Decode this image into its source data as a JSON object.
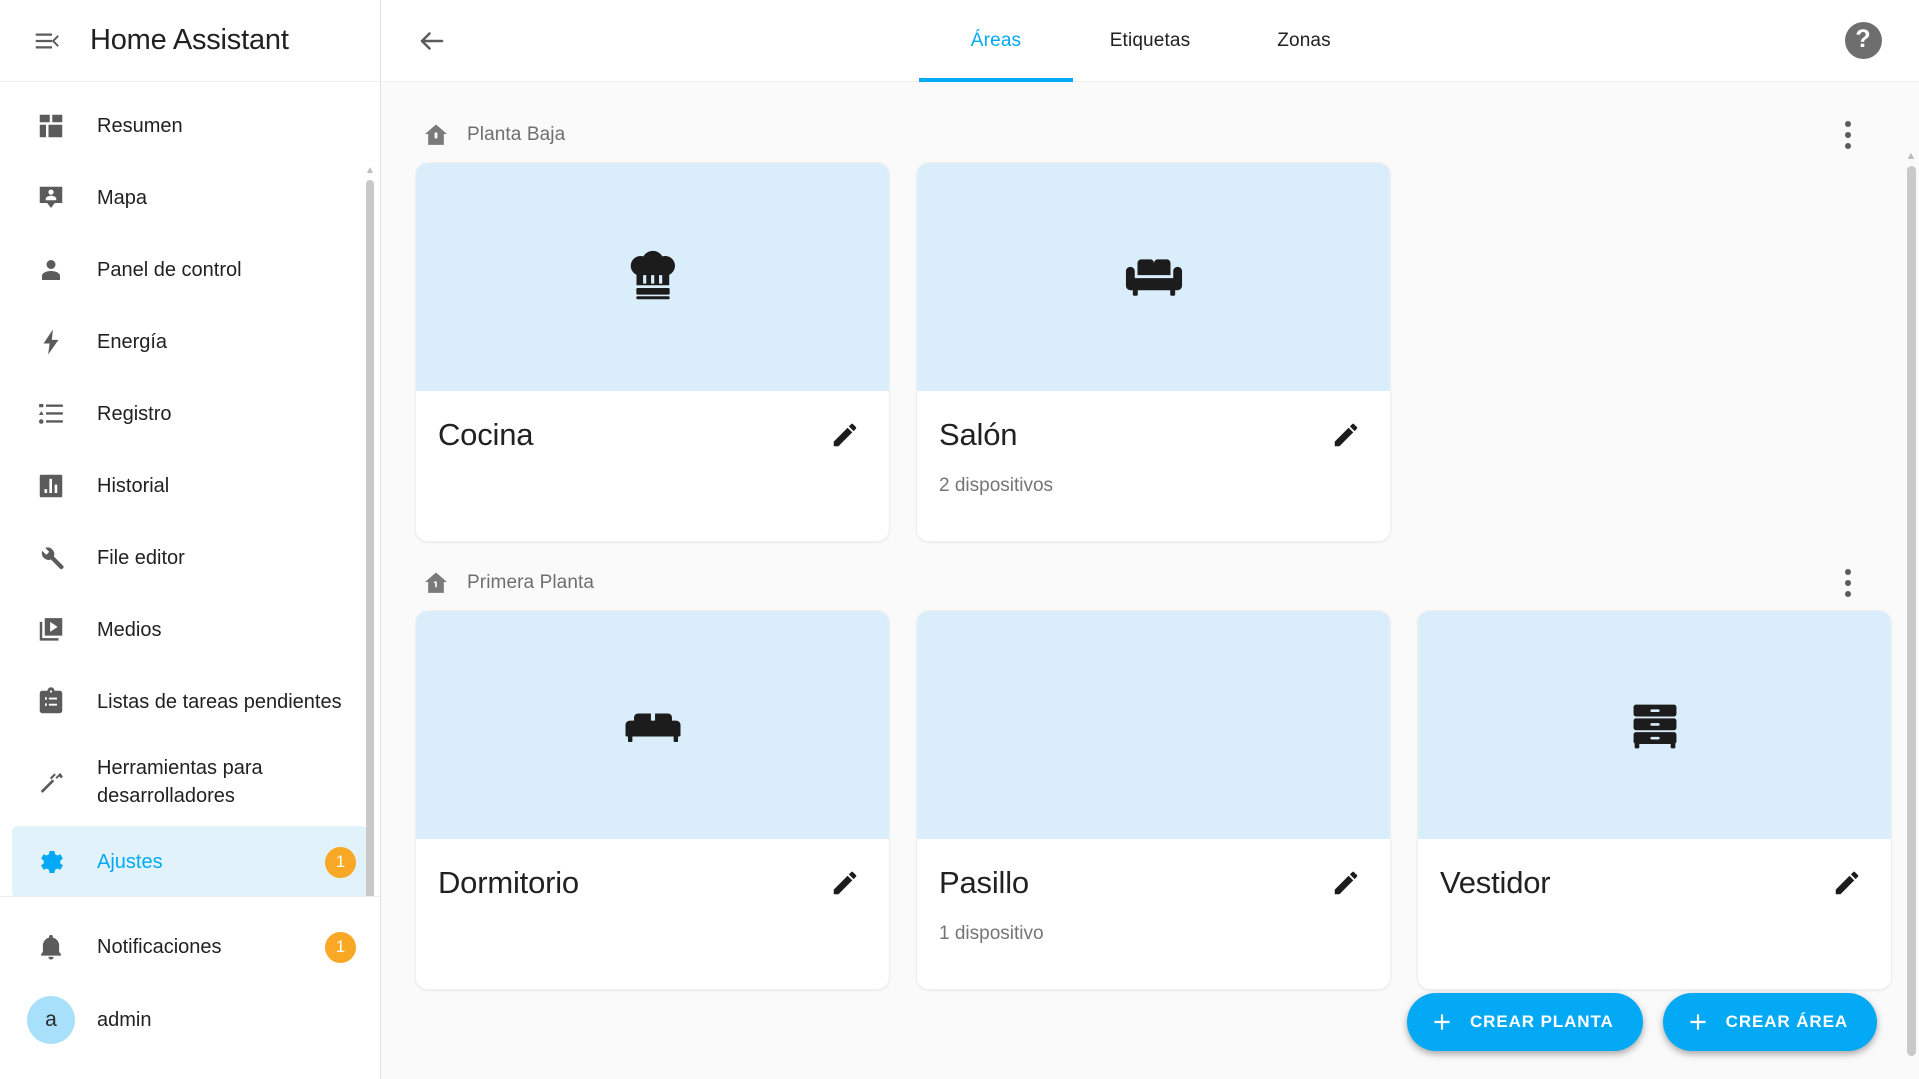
{
  "app": {
    "title": "Home Assistant",
    "menu_icon": "menu-collapse-icon"
  },
  "sidebar": {
    "items": [
      {
        "label": "Resumen",
        "icon": "dashboard-icon"
      },
      {
        "label": "Mapa",
        "icon": "map-marker-account-icon"
      },
      {
        "label": "Panel de control",
        "icon": "account-icon"
      },
      {
        "label": "Energía",
        "icon": "lightning-bolt-icon"
      },
      {
        "label": "Registro",
        "icon": "format-list-icon"
      },
      {
        "label": "Historial",
        "icon": "chart-box-icon"
      },
      {
        "label": "File editor",
        "icon": "wrench-icon"
      },
      {
        "label": "Medios",
        "icon": "play-box-multiple-icon"
      },
      {
        "label": "Listas de tareas pendientes",
        "icon": "clipboard-list-icon"
      },
      {
        "label": "Herramientas para desarrolladores",
        "icon": "hammer-icon"
      },
      {
        "label": "Ajustes",
        "icon": "cog-icon",
        "badge": "1",
        "active": true
      }
    ],
    "footer": {
      "notifications": {
        "label": "Notificaciones",
        "icon": "bell-icon",
        "badge": "1"
      },
      "user": {
        "label": "admin",
        "initial": "a"
      }
    }
  },
  "topbar": {
    "back_icon": "arrow-left-icon",
    "help_icon": "help-circle-icon",
    "help_glyph": "?",
    "tabs": [
      {
        "label": "Áreas",
        "active": true
      },
      {
        "label": "Etiquetas",
        "active": false
      },
      {
        "label": "Zonas",
        "active": false
      }
    ]
  },
  "floors": [
    {
      "name": "Planta Baja",
      "icon": "home-floor-0-icon",
      "menu_icon": "dots-vertical-icon",
      "areas": [
        {
          "name": "Cocina",
          "icon": "chef-hat-icon",
          "devices": "",
          "edit_icon": "pencil-icon"
        },
        {
          "name": "Salón",
          "icon": "sofa-icon",
          "devices": "2 dispositivos",
          "edit_icon": "pencil-icon"
        }
      ]
    },
    {
      "name": "Primera Planta",
      "icon": "home-floor-1-icon",
      "menu_icon": "dots-vertical-icon",
      "areas": [
        {
          "name": "Dormitorio",
          "icon": "bed-icon",
          "devices": "",
          "edit_icon": "pencil-icon"
        },
        {
          "name": "Pasillo",
          "icon": "",
          "devices": "1 dispositivo",
          "edit_icon": "pencil-icon"
        },
        {
          "name": "Vestidor",
          "icon": "dresser-icon",
          "devices": "",
          "edit_icon": "pencil-icon"
        }
      ]
    }
  ],
  "fabs": [
    {
      "label": "CREAR PLANTA",
      "icon": "plus-icon"
    },
    {
      "label": "CREAR ÁREA",
      "icon": "plus-icon"
    }
  ],
  "colors": {
    "accent": "#03a9f4",
    "badge": "#f9a825",
    "card_image_bg": "#daedfa",
    "page_bg": "#fafafa",
    "avatar_bg": "#a8dffa"
  }
}
